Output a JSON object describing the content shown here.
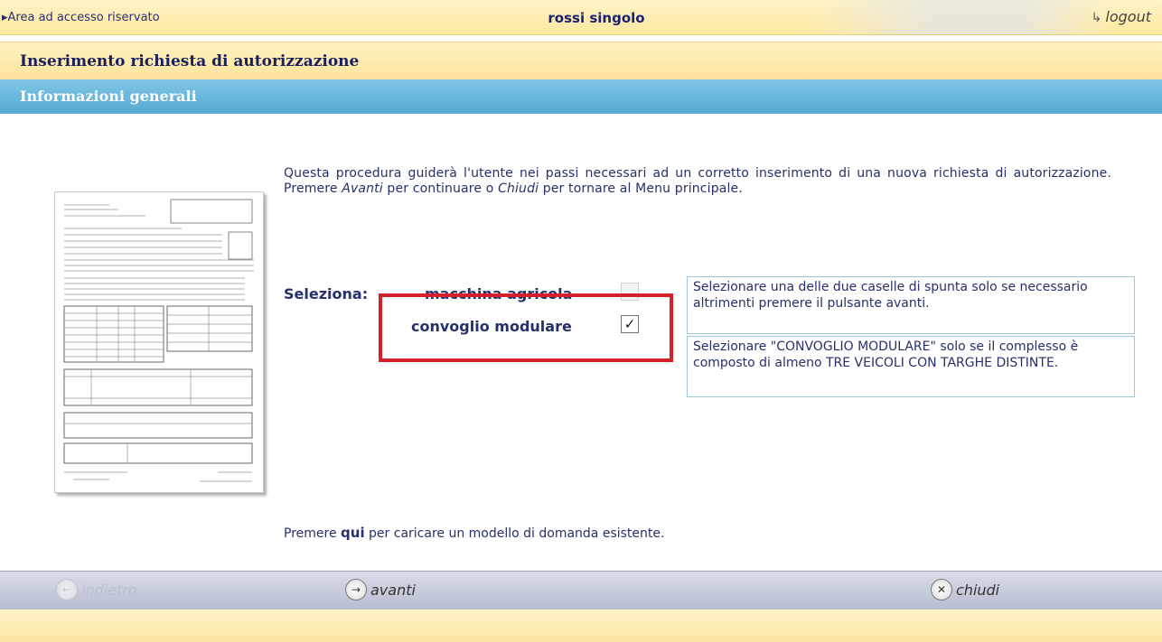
{
  "header": {
    "area_label": "Area ad accesso riservato",
    "user_name": "rossi singolo",
    "logout_label": "logout",
    "logout_icon": "logout-arrow-icon"
  },
  "page": {
    "title": "Inserimento richiesta di autorizzazione",
    "section_title": "Informazioni generali"
  },
  "intro": {
    "part1": "Questa procedura guiderà l'utente nei passi necessari ad un corretto inserimento di una nuova richiesta di autorizzazione. Premere ",
    "avanti": "Avanti",
    "part2": " per continuare o ",
    "chiudi": "Chiudi",
    "part3": " per tornare al Menu principale."
  },
  "selection": {
    "label": "Seleziona:",
    "option_agricola": "macchina agricola",
    "option_agricola_checked": false,
    "option_convoglio": "convoglio modulare",
    "option_convoglio_checked": true,
    "checkmark": "✓"
  },
  "info": {
    "box1": "Selezionare una delle due caselle di spunta solo se necessario altrimenti premere il pulsante avanti.",
    "box2": "Selezionare \"CONVOGLIO MODULARE\" solo se il complesso è composto di almeno TRE VEICOLI CON TARGHE DISTINTE."
  },
  "hint": {
    "before": "Premere ",
    "link": "qui",
    "after": " per caricare un modello di domanda esistente."
  },
  "footer": {
    "back_label": "indietro",
    "back_icon": "arrow-left-icon",
    "back_enabled": false,
    "next_label": "avanti",
    "next_icon": "arrow-right-icon",
    "close_label": "chiudi",
    "close_icon": "close-icon"
  },
  "colors": {
    "header_yellow": "#fde7a0",
    "section_blue": "#56a9d2",
    "text_navy": "#26306a",
    "highlight_red": "#d71f2a",
    "footer_gray": "#b7bdcf"
  }
}
